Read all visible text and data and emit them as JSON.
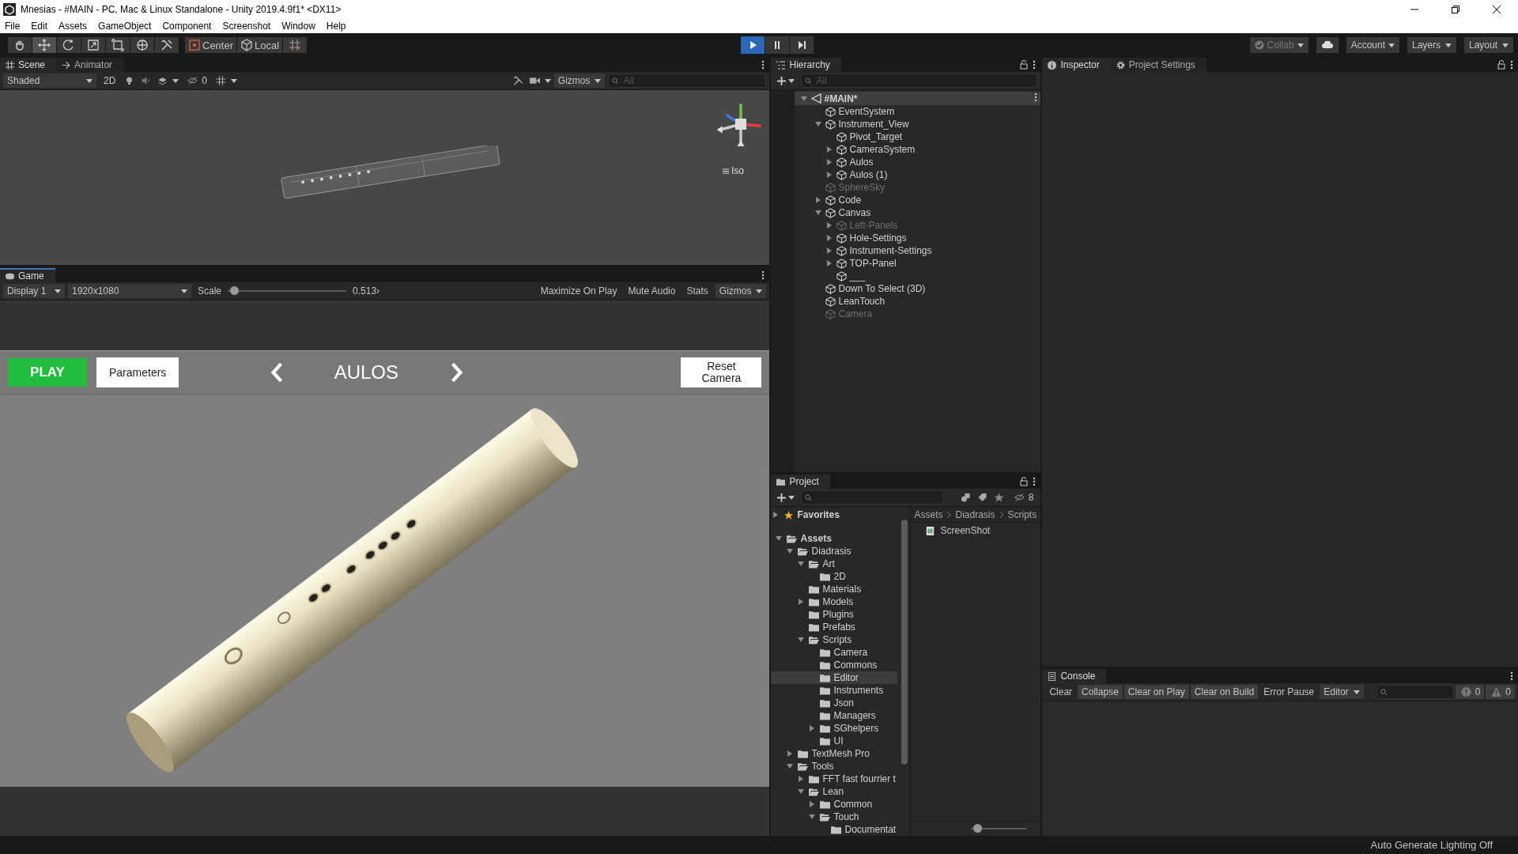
{
  "window": {
    "title": "Mnesias - #MAIN - PC, Mac & Linux Standalone - Unity 2019.4.9f1* <DX11>"
  },
  "menu": [
    "File",
    "Edit",
    "Assets",
    "GameObject",
    "Component",
    "Screenshot",
    "Window",
    "Help"
  ],
  "toolbar": {
    "tools": [
      {
        "kind": "hand",
        "selected": false
      },
      {
        "kind": "move",
        "selected": true
      },
      {
        "kind": "rotate",
        "selected": false
      },
      {
        "kind": "scale",
        "selected": false
      },
      {
        "kind": "rect",
        "selected": false
      },
      {
        "kind": "transform",
        "selected": false
      },
      {
        "kind": "custom",
        "selected": false
      }
    ],
    "pivot": "Center",
    "space": "Local",
    "playback": [
      {
        "kind": "play",
        "on": true
      },
      {
        "kind": "pause",
        "on": false
      },
      {
        "kind": "step",
        "on": false
      }
    ],
    "collab": "Collab",
    "account": "Account",
    "layers": "Layers",
    "layout": "Layout"
  },
  "scene_panel": {
    "tabs": [
      {
        "label": "Scene",
        "kind": "scene",
        "selected": true
      },
      {
        "label": "Animator",
        "kind": "animator",
        "selected": false
      }
    ],
    "shading": "Shaded",
    "mode_2d": {
      "label": "2D",
      "on": false
    },
    "hidden_count": "0",
    "gizmos": "Gizmos",
    "search": {
      "placeholder": "All"
    },
    "projection": "Iso"
  },
  "game_panel": {
    "tab": "Game",
    "display": "Display 1",
    "resolution": "1920x1080",
    "scale_label": "Scale",
    "scale": {
      "level": 0.02
    },
    "scale_value": "0.513›",
    "toggles": [
      {
        "label": "Maximize On Play",
        "on": false
      },
      {
        "label": "Mute Audio",
        "on": false
      },
      {
        "label": "Stats",
        "on": false
      }
    ],
    "gizmos": "Gizmos",
    "game_ui": {
      "play": "PLAY",
      "parameters": "Parameters",
      "instrument": "AULOS",
      "reset": "Reset Camera"
    }
  },
  "hierarchy": {
    "title": "Hierarchy",
    "search": {
      "placeholder": "All"
    },
    "scene": {
      "label": "#MAIN*",
      "expanded": true
    },
    "items": [
      {
        "label": "EventSystem",
        "disabled": false
      },
      {
        "label": "Instrument_View",
        "disabled": false,
        "expanded": true,
        "children": [
          {
            "label": "Pivot_Target",
            "disabled": false
          },
          {
            "label": "CameraSystem",
            "disabled": false,
            "expanded": false
          },
          {
            "label": "Aulos",
            "disabled": false,
            "expanded": false
          },
          {
            "label": "Aulos (1)",
            "disabled": false,
            "expanded": false
          }
        ]
      },
      {
        "label": "SphereSky",
        "disabled": true
      },
      {
        "label": "Code",
        "disabled": false,
        "expanded": false
      },
      {
        "label": "Canvas",
        "disabled": false,
        "expanded": true,
        "children": [
          {
            "label": "Left-Panels",
            "disabled": true,
            "expanded": false
          },
          {
            "label": "Hole-Settings",
            "disabled": false,
            "expanded": false
          },
          {
            "label": "Instrument-Settings",
            "disabled": false,
            "expanded": false
          },
          {
            "label": "TOP-Panel",
            "disabled": false,
            "expanded": false
          },
          {
            "label": "___",
            "disabled": false
          }
        ]
      },
      {
        "label": "Down To Select (3D)",
        "disabled": false
      },
      {
        "label": "LeanTouch",
        "disabled": false
      },
      {
        "label": "Camera",
        "disabled": true
      }
    ]
  },
  "project": {
    "title": "Project",
    "hidden_count": "8",
    "favorites": {
      "label": "Favorites",
      "expanded": false
    },
    "tree": [
      {
        "label": "Assets",
        "selected": false,
        "expanded": true,
        "children": [
          {
            "label": "Diadrasis",
            "selected": false,
            "expanded": true,
            "children": [
              {
                "label": "Art",
                "selected": false,
                "expanded": true,
                "children": [
                  {
                    "label": "2D",
                    "selected": false
                  }
                ]
              },
              {
                "label": "Materials",
                "selected": false
              },
              {
                "label": "Models",
                "selected": false,
                "expanded": false
              },
              {
                "label": "Plugins",
                "selected": false
              },
              {
                "label": "Prefabs",
                "selected": false
              },
              {
                "label": "Scripts",
                "selected": false,
                "expanded": true,
                "children": [
                  {
                    "label": "Camera",
                    "selected": false
                  },
                  {
                    "label": "Commons",
                    "selected": false
                  },
                  {
                    "label": "Editor",
                    "selected": true
                  },
                  {
                    "label": "Instruments",
                    "selected": false
                  },
                  {
                    "label": "Json",
                    "selected": false
                  },
                  {
                    "label": "Managers",
                    "selected": false
                  },
                  {
                    "label": "SGhelpers",
                    "selected": false,
                    "expanded": false
                  },
                  {
                    "label": "UI",
                    "selected": false
                  }
                ]
              }
            ]
          },
          {
            "label": "TextMesh Pro",
            "selected": false,
            "expanded": false
          },
          {
            "label": "Tools",
            "selected": false,
            "expanded": true,
            "children": [
              {
                "label": "FFT fast fourrier t",
                "selected": false,
                "expanded": false
              },
              {
                "label": "Lean",
                "selected": false,
                "expanded": true,
                "children": [
                  {
                    "label": "Common",
                    "selected": false,
                    "expanded": false
                  },
                  {
                    "label": "Touch",
                    "selected": false,
                    "expanded": true,
                    "children": [
                      {
                        "label": "Documentat",
                        "selected": false
                      }
                    ]
                  }
                ]
              }
            ]
          }
        ]
      }
    ],
    "breadcrumb": [
      "Assets",
      "Diadrasis",
      "Scripts"
    ],
    "files": [
      "ScreenShot"
    ],
    "icon_size": {
      "level": 0.05
    }
  },
  "inspector": {
    "tabs": [
      {
        "label": "Inspector",
        "kind": "info",
        "selected": true
      },
      {
        "label": "Project Settings",
        "kind": "gear",
        "selected": false
      }
    ]
  },
  "console": {
    "title": "Console",
    "buttons": [
      {
        "label": "Clear",
        "kind": "button"
      },
      {
        "label": "Collapse",
        "kind": "toggle",
        "on": true
      },
      {
        "label": "Clear on Play",
        "kind": "toggle",
        "on": true
      },
      {
        "label": "Clear on Build",
        "kind": "toggle",
        "on": true
      },
      {
        "label": "Error Pause",
        "kind": "toggle",
        "on": false
      }
    ],
    "mode": "Editor",
    "errors": "0",
    "warnings": "0"
  },
  "status_bar": {
    "text": "Auto Generate Lighting Off"
  }
}
